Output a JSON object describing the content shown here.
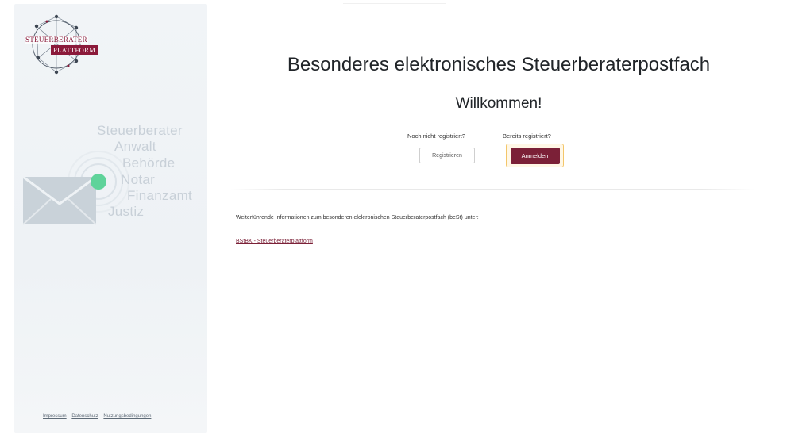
{
  "sidebar": {
    "logo": {
      "line1": "STEUERBERATER",
      "line2": "PLATTFORM"
    },
    "illustration_words": [
      "Steuerberater",
      "Anwalt",
      "Behörde",
      "Notar",
      "Finanzamt",
      "Justiz"
    ],
    "footer_links": [
      "Impressum",
      "Datenschutz",
      "Nutzungsbedingungen"
    ]
  },
  "main": {
    "title": "Besonderes elektronisches Steuerberaterpostfach",
    "welcome": "Willkommen!",
    "register": {
      "label": "Noch nicht registriert?",
      "button": "Registrieren"
    },
    "login": {
      "label": "Bereits registriert?",
      "button": "Anmelden"
    },
    "info_text": "Weiterführende Informationen zum besonderen elektronischen Steuerberaterpostfach (beSt) unter:",
    "info_link": "BStBK - Steuerberaterplattform"
  },
  "colors": {
    "brand": "#7b2037",
    "accent_green": "#5fd39a",
    "sidebar_bg": "#eef2f5"
  }
}
